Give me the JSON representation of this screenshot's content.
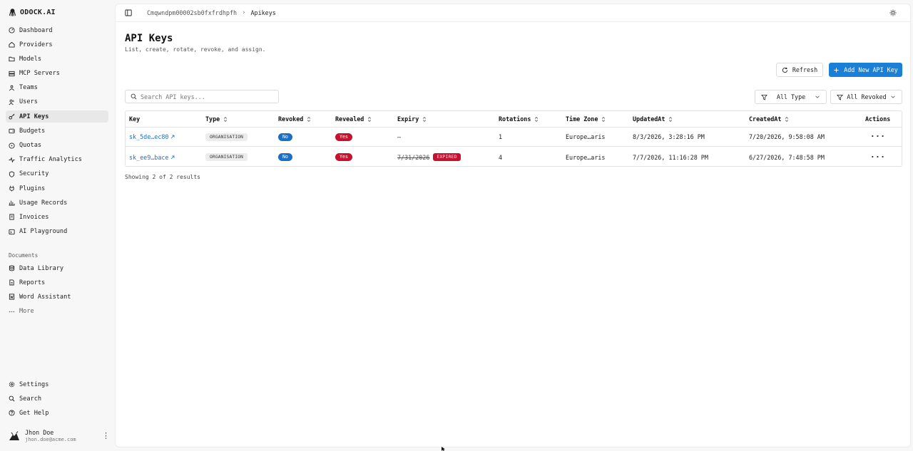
{
  "brand": {
    "name": "ODOCK.AI"
  },
  "sidebar": {
    "items": [
      {
        "label": "Dashboard",
        "icon": "dashboard-icon"
      },
      {
        "label": "Providers",
        "icon": "home-icon"
      },
      {
        "label": "Models",
        "icon": "folder-icon"
      },
      {
        "label": "MCP Servers",
        "icon": "server-icon"
      },
      {
        "label": "Teams",
        "icon": "team-icon"
      },
      {
        "label": "Users",
        "icon": "users-icon"
      },
      {
        "label": "API Keys",
        "icon": "key-icon",
        "active": true
      },
      {
        "label": "Budgets",
        "icon": "wallet-icon"
      },
      {
        "label": "Quotas",
        "icon": "gauge-icon"
      },
      {
        "label": "Traffic Analytics",
        "icon": "activity-icon"
      },
      {
        "label": "Security",
        "icon": "shield-icon"
      },
      {
        "label": "Plugins",
        "icon": "plug-icon"
      },
      {
        "label": "Usage Records",
        "icon": "bar-chart-icon"
      },
      {
        "label": "Invoices",
        "icon": "invoice-icon"
      },
      {
        "label": "AI Playground",
        "icon": "playground-icon"
      }
    ],
    "documents_label": "Documents",
    "documents": [
      {
        "label": "Data Library",
        "icon": "database-icon"
      },
      {
        "label": "Reports",
        "icon": "report-icon"
      },
      {
        "label": "Word Assistant",
        "icon": "word-icon"
      }
    ],
    "more_label": "More",
    "bottom": [
      {
        "label": "Settings",
        "icon": "gear-icon"
      },
      {
        "label": "Search",
        "icon": "search-icon"
      },
      {
        "label": "Get Help",
        "icon": "help-icon"
      }
    ]
  },
  "user": {
    "name": "Jhon Doe",
    "email": "jhon.doe@acme.com"
  },
  "breadcrumb": {
    "org": "Cmqwndpm00002sb0fxfrdhpfh",
    "page": "Apikeys"
  },
  "page": {
    "title": "API Keys",
    "subtitle": "List, create, rotate, revoke, and assign."
  },
  "toolbar": {
    "refresh_label": "Refresh",
    "add_label": "Add New API Key"
  },
  "search": {
    "placeholder": "Search API keys...",
    "value": ""
  },
  "filters": {
    "type": "All Type",
    "revoked": "All Revoked"
  },
  "table": {
    "columns": [
      "Key",
      "Type",
      "Revoked",
      "Revealed",
      "Expiry",
      "Rotations",
      "Time Zone",
      "UpdatedAt",
      "CreatedAt",
      "Actions"
    ],
    "rows": [
      {
        "key": "sk_5de…ec80",
        "type": "ORGANISATION",
        "revoked": "No",
        "revealed": "Yes",
        "expiry": "—",
        "expired_label": "",
        "rotations": "1",
        "timezone": "Europe…aris",
        "updated": "8/3/2026, 3:28:16 PM",
        "created": "7/20/2026, 9:58:08 AM"
      },
      {
        "key": "sk_ee9…bace",
        "type": "ORGANISATION",
        "revoked": "No",
        "revealed": "Yes",
        "expiry": "7/31/2026",
        "expired_label": "EXPIRED",
        "rotations": "4",
        "timezone": "Europe…aris",
        "updated": "7/7/2026, 11:16:28 PM",
        "created": "6/27/2026, 7:48:58 PM"
      }
    ]
  },
  "results_text": "Showing 2 of 2 results",
  "colors": {
    "accent": "#1a7fd6",
    "danger": "#c4122f",
    "info": "#1b6fc4"
  }
}
